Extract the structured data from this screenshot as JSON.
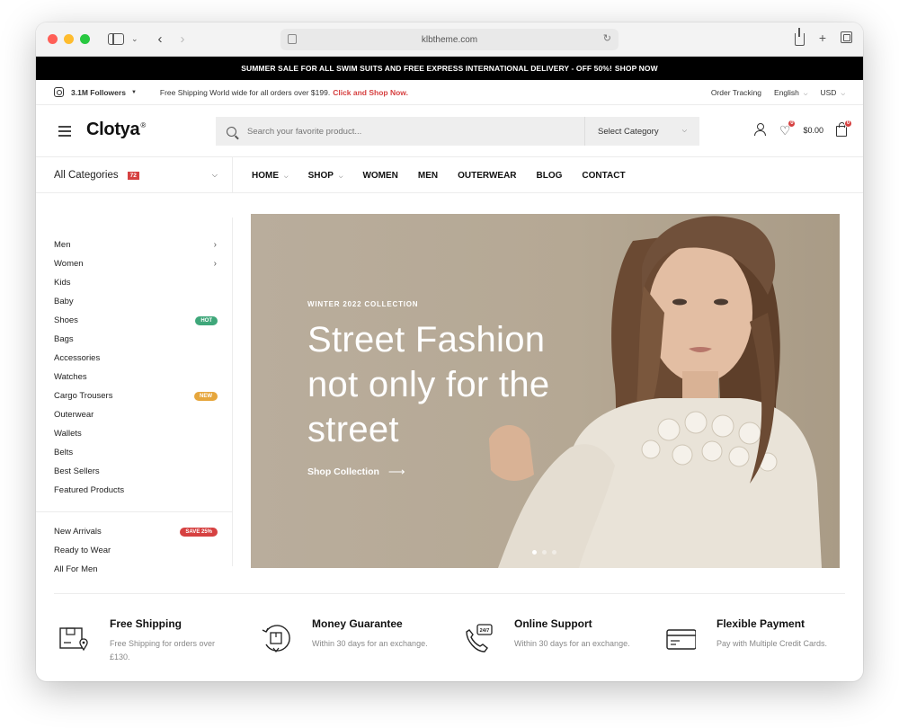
{
  "browser": {
    "url": "klbtheme.com"
  },
  "promo": {
    "text": "SUMMER SALE FOR ALL SWIM SUITS AND FREE EXPRESS INTERNATIONAL DELIVERY - OFF 50%!",
    "cta": "SHOP NOW"
  },
  "topbar": {
    "followers": "3.1M Followers",
    "shipping_text": "Free Shipping World wide for all orders over $199.",
    "shipping_link": "Click and Shop Now.",
    "order_tracking": "Order Tracking",
    "language": "English",
    "currency": "USD"
  },
  "header": {
    "logo": "Clotya",
    "logo_mark": "®",
    "search_placeholder": "Search your favorite product...",
    "search_category": "Select Category",
    "wishlist_count": "0",
    "cart_total": "$0.00",
    "cart_count": "0"
  },
  "nav": {
    "all_categories": "All Categories",
    "category_count": "72",
    "items": [
      "HOME",
      "SHOP",
      "WOMEN",
      "MEN",
      "OUTERWEAR",
      "BLOG",
      "CONTACT"
    ]
  },
  "sidebar": {
    "categories": [
      {
        "label": "Men"
      },
      {
        "label": "Women"
      },
      {
        "label": "Kids"
      },
      {
        "label": "Baby"
      },
      {
        "label": "Shoes",
        "tag": "HOT"
      },
      {
        "label": "Bags"
      },
      {
        "label": "Accessories"
      },
      {
        "label": "Watches"
      },
      {
        "label": "Cargo Trousers",
        "tag": "NEW"
      },
      {
        "label": "Outerwear"
      },
      {
        "label": "Wallets"
      },
      {
        "label": "Belts"
      },
      {
        "label": "Best Sellers"
      },
      {
        "label": "Featured Products"
      }
    ],
    "extra": [
      {
        "label": "New Arrivals",
        "tag": "SAVE 25%"
      },
      {
        "label": "Ready to Wear"
      },
      {
        "label": "All For Men"
      }
    ]
  },
  "hero": {
    "eyebrow": "WINTER 2022 COLLECTION",
    "title": "Street Fashion not only for the street",
    "cta": "Shop Collection",
    "active_slide": 1,
    "slide_count": 3
  },
  "features": [
    {
      "icon": "shipping-box-icon",
      "title": "Free Shipping",
      "desc": "Free Shipping for orders over £130."
    },
    {
      "icon": "money-guarantee-icon",
      "title": "Money Guarantee",
      "desc": "Within 30 days for an exchange."
    },
    {
      "icon": "support-phone-icon",
      "title": "Online Support",
      "desc": "Within 30 days for an exchange."
    },
    {
      "icon": "credit-card-icon",
      "title": "Flexible Payment",
      "desc": "Pay with Multiple Credit Cards."
    }
  ],
  "colors": {
    "accent": "#d64141",
    "hot": "#3fa77a",
    "new": "#e6a63c",
    "save": "#d64141",
    "hero_bg": "#b9ac99"
  }
}
